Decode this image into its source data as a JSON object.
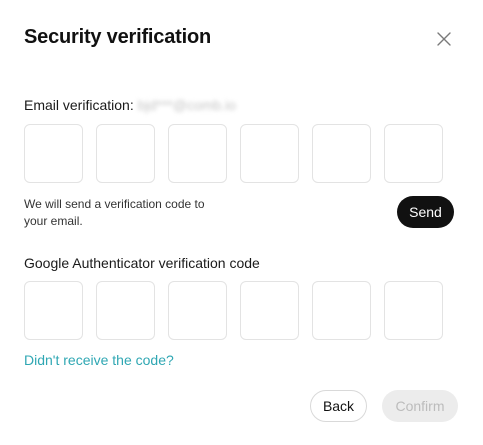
{
  "dialog": {
    "title": "Security verification"
  },
  "email_section": {
    "label": "Email verification:",
    "masked_email": "bjd***@comb.io",
    "hint": "We will send a verification code to your email.",
    "send_label": "Send",
    "code_boxes": [
      "",
      "",
      "",
      "",
      "",
      ""
    ]
  },
  "ga_section": {
    "label": "Google Authenticator verification code",
    "code_boxes": [
      "",
      "",
      "",
      "",
      "",
      ""
    ]
  },
  "resend_link": "Didn't receive the code?",
  "footer": {
    "back_label": "Back",
    "confirm_label": "Confirm"
  },
  "colors": {
    "accent_link": "#2fa7b3",
    "primary_button": "#111111",
    "disabled_button_bg": "#ececec",
    "disabled_button_text": "#bcbcbc"
  },
  "icons": {
    "close": "close-icon"
  }
}
